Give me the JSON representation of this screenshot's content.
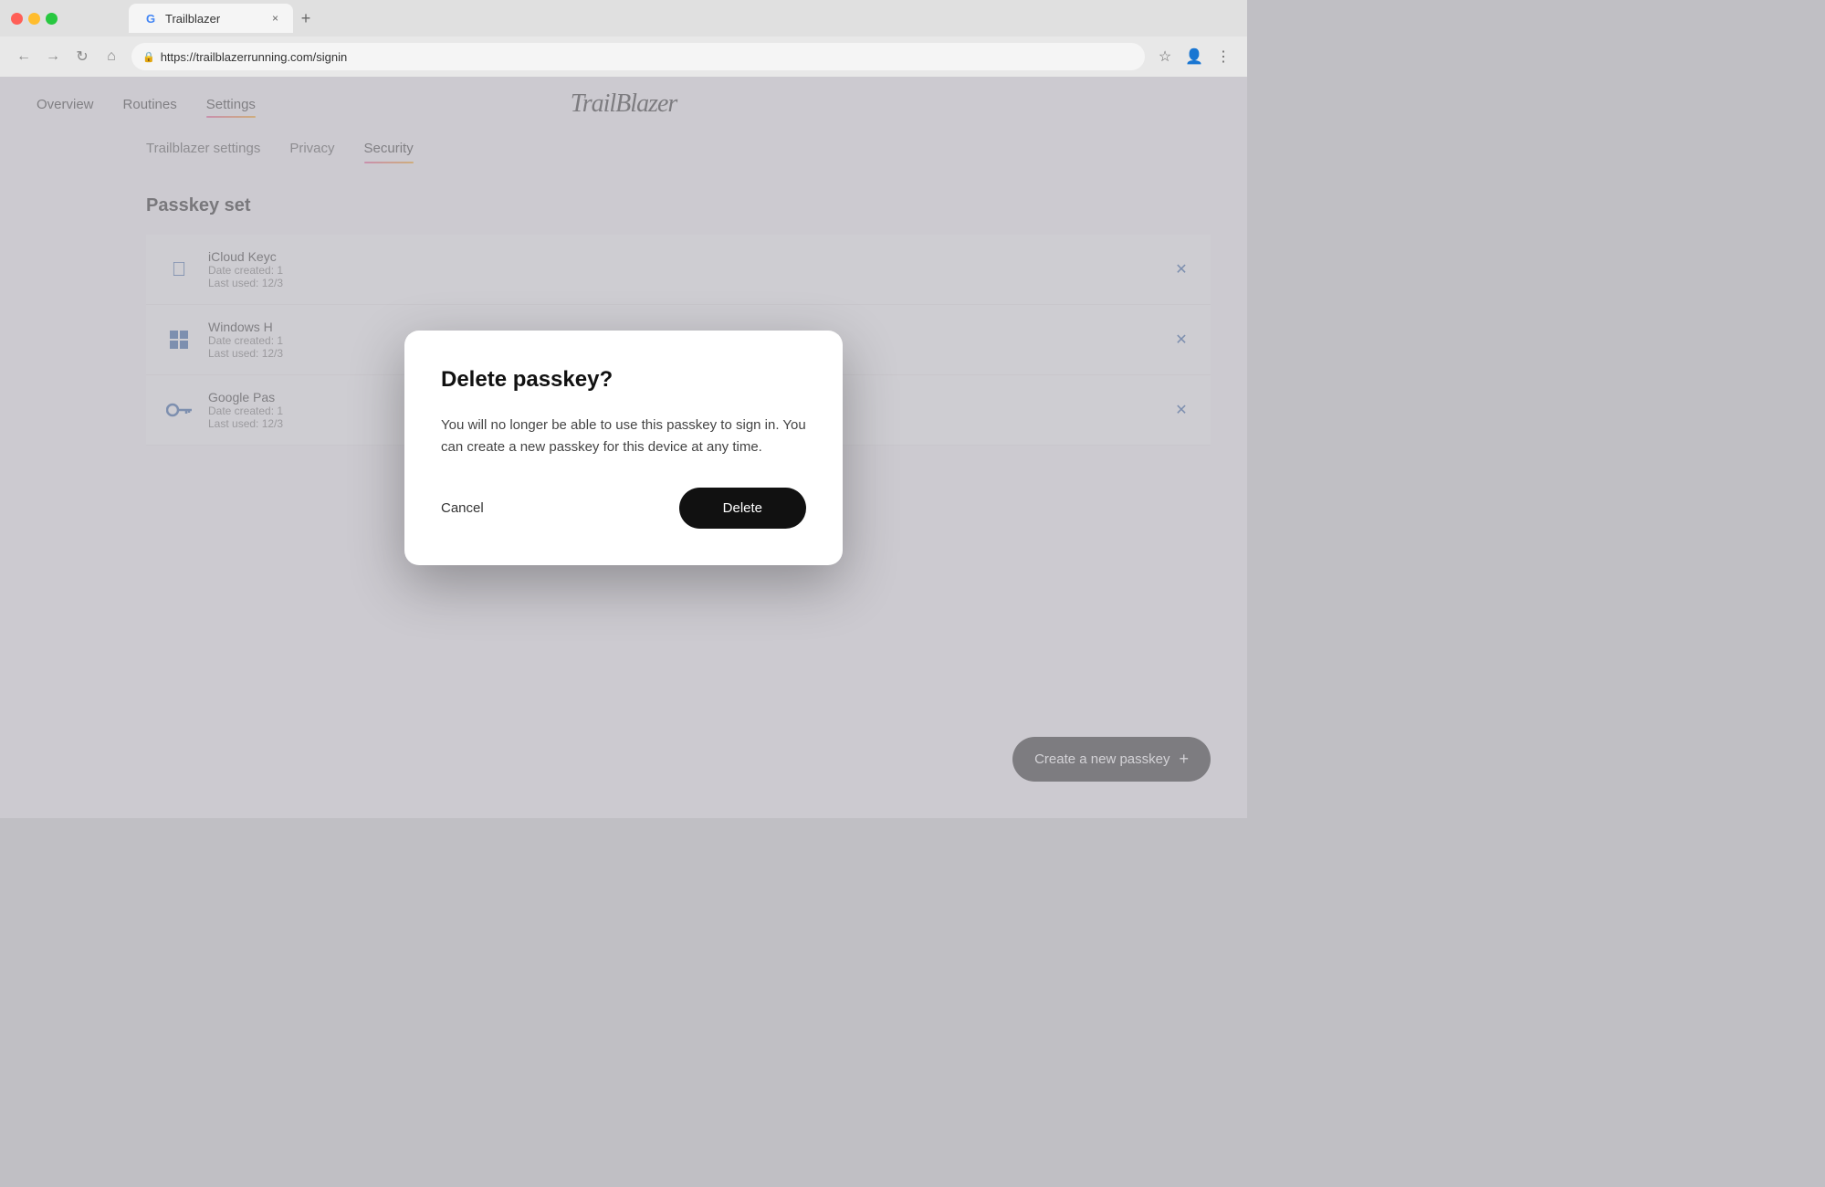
{
  "browser": {
    "tab_title": "Trailblazer",
    "url": "https://trailblazerrunning.com/signin",
    "close_label": "×",
    "new_tab_label": "+"
  },
  "nav": {
    "overview": "Overview",
    "routines": "Routines",
    "settings": "Settings"
  },
  "logo": "TrailBlazer",
  "settings_tabs": [
    {
      "id": "trailblazer-settings",
      "label": "Trailblazer settings"
    },
    {
      "id": "privacy",
      "label": "Privacy"
    },
    {
      "id": "security",
      "label": "Security"
    }
  ],
  "passkey_section": {
    "title": "Passkey set",
    "items": [
      {
        "id": "icloud",
        "name": "iCloud Keyc",
        "date_created": "Date created: 1",
        "last_used": "Last used: 12/3"
      },
      {
        "id": "windows",
        "name": "Windows H",
        "date_created": "Date created: 1",
        "last_used": "Last used: 12/3"
      },
      {
        "id": "google",
        "name": "Google Pas",
        "date_created": "Date created: 1",
        "last_used": "Last used: 12/3"
      }
    ]
  },
  "create_passkey_button": "Create a new passkey",
  "modal": {
    "title": "Delete passkey?",
    "body": "You will no longer be able to use this passkey to sign in. You can create a new passkey for this device at any time.",
    "cancel_label": "Cancel",
    "delete_label": "Delete"
  }
}
